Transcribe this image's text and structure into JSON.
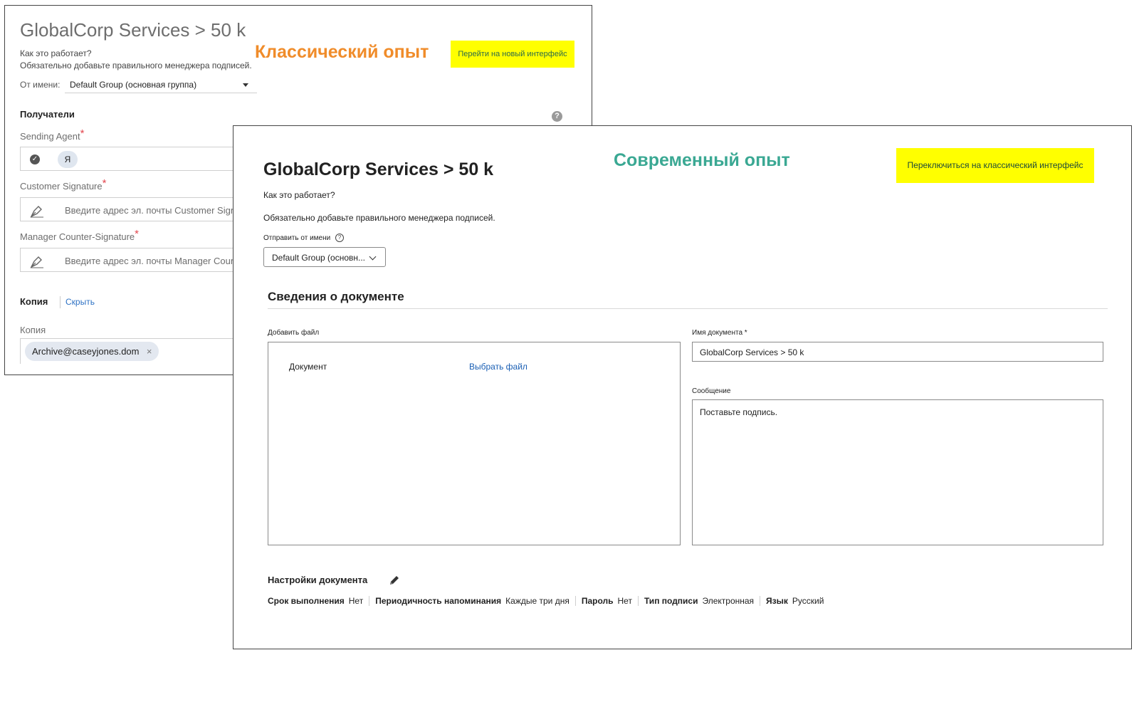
{
  "classic": {
    "title": "GlobalCorp Services > 50 k",
    "how_it_works": "Как это работает?",
    "note": "Обязательно добавьте правильного менеджера подписей.",
    "from_label": "От имени:",
    "from_value": "Default Group (основная группа)",
    "experience_tag": "Классический опыт",
    "switch_button": "Перейти на новый интерфейс",
    "recipients_heading": "Получатели",
    "help_icon": "question-circle-icon",
    "recipients": [
      {
        "label": "Sending Agent",
        "required": "*",
        "value": "Я"
      },
      {
        "label": "Customer Signature",
        "required": "*",
        "placeholder": "Введите адрес эл. почты Customer Sign"
      },
      {
        "label": "Manager Counter-Signature",
        "required": "*",
        "placeholder": "Введите адрес эл. почты Manager Coun"
      }
    ],
    "copy_heading": "Копия",
    "hide_link": "Скрыть",
    "copy_label": "Копия",
    "copy_email": "Archive@caseyjones.dom",
    "remove_icon": "×"
  },
  "modern": {
    "title": "GlobalCorp Services > 50 k",
    "experience_tag": "Современный опыт",
    "switch_button": "Переключиться на классический интерфейс",
    "how_it_works": "Как это работает?",
    "note": "Обязательно добавьте правильного менеджера подписей.",
    "send_from_label": "Отправить от имени",
    "send_from_value": "Default Group (основн...",
    "help_icon": "?",
    "section_title": "Сведения о документе",
    "add_file_label": "Добавить файл",
    "document_label": "Документ",
    "choose_file": "Выбрать файл",
    "doc_name_label": "Имя документа",
    "doc_name_required": "*",
    "doc_name_value": "GlobalCorp Services  >  50 k",
    "message_label": "Сообщение",
    "message_value": "Поставьте подпись.",
    "settings_title": "Настройки документа",
    "settings": [
      {
        "key": "Срок выполнения",
        "value": "Нет"
      },
      {
        "key": "Периодичность напоминания",
        "value": "Каждые три дня"
      },
      {
        "key": "Пароль",
        "value": "Нет"
      },
      {
        "key": "Тип подписи",
        "value": "Электронная"
      },
      {
        "key": "Язык",
        "value": "Русский"
      }
    ]
  },
  "colors": {
    "classic_tag": "#f08c2a",
    "modern_tag": "#3aa893",
    "highlight": "#ffff00",
    "link": "#1a5fb4",
    "required": "#e34850"
  }
}
